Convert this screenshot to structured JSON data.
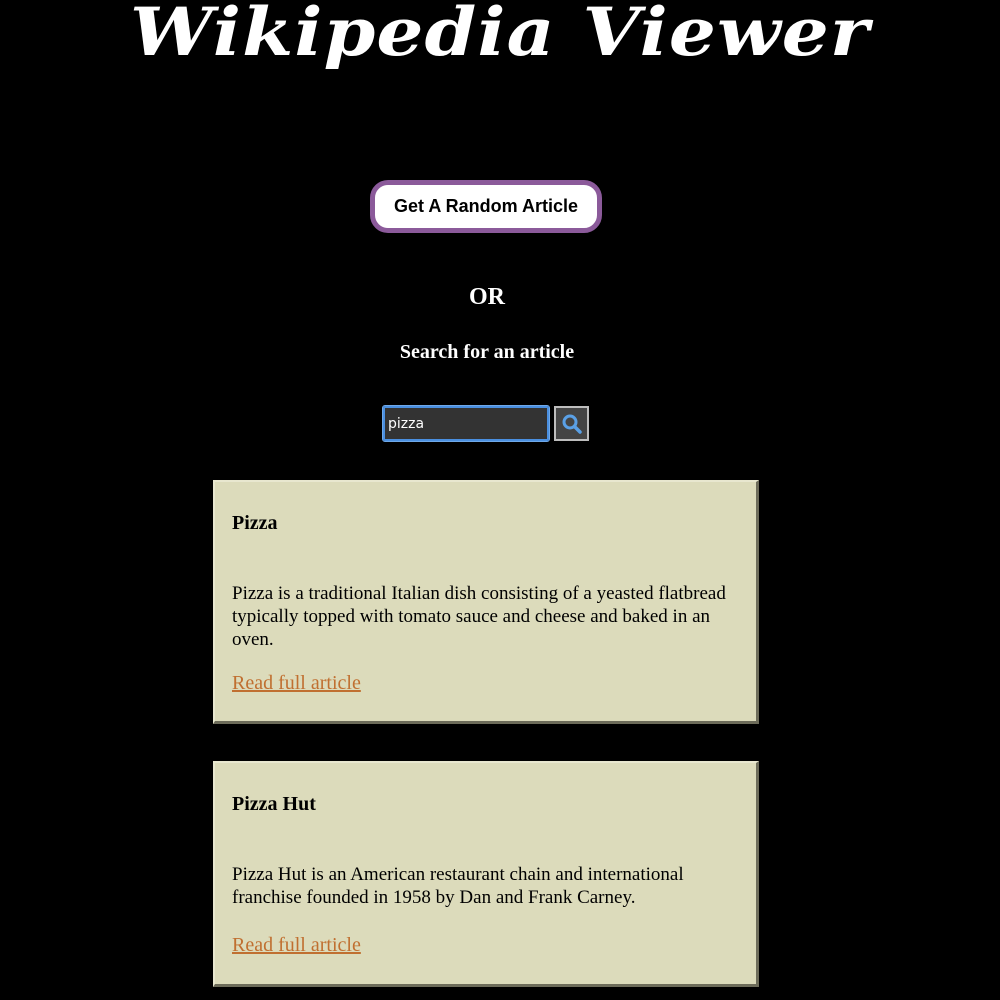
{
  "header": {
    "title": "Wikipedia Viewer"
  },
  "random": {
    "button_label": "Get A Random Article",
    "border_color": "#8b5a9a"
  },
  "divider": {
    "or_text": "OR"
  },
  "search": {
    "heading": "Search for an article",
    "value": "pizza",
    "placeholder": "",
    "button_icon": "search-icon",
    "input_border_color": "#4a8fe0"
  },
  "results": [
    {
      "title": "Pizza",
      "description": "Pizza is a traditional Italian dish consisting of a yeasted flatbread typically topped with tomato sauce and cheese and baked in an oven.",
      "link_label": "Read full article"
    },
    {
      "title": "Pizza Hut",
      "description": "Pizza Hut is an American restaurant chain and international franchise founded in 1958 by Dan and Frank Carney.",
      "link_label": "Read full article"
    }
  ],
  "colors": {
    "background": "#000000",
    "card_background": "#dcdbbb",
    "link": "#c06f30"
  }
}
